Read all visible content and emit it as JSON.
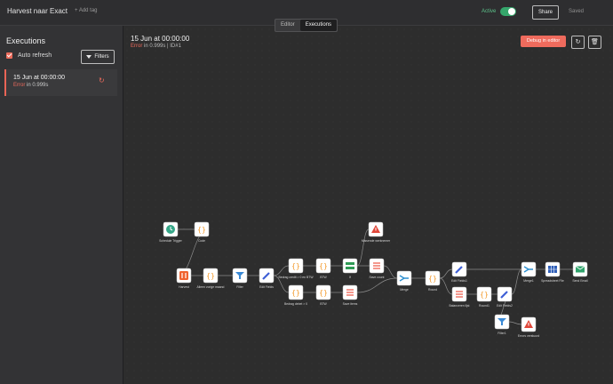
{
  "header": {
    "workflow_title": "Harvest naar Exact",
    "add_tag": "+ Add tag",
    "active_label": "Active",
    "active": true,
    "share_label": "Share",
    "saved_label": "Saved",
    "tabs": [
      {
        "label": "Editor",
        "selected": false
      },
      {
        "label": "Executions",
        "selected": true
      }
    ]
  },
  "sidebar": {
    "title": "Executions",
    "auto_refresh_label": "Auto refresh",
    "auto_refresh_checked": true,
    "filters_label": "Filters",
    "executions": [
      {
        "title": "15 Jun at 00:00:00",
        "status_word": "Error",
        "status_rest": " in 0.999s"
      }
    ]
  },
  "detail": {
    "title": "15 Jun at 00:00:00",
    "status_word": "Error",
    "status_rest": " in 0.999s | ID#1",
    "debug_label": "Debug in editor"
  },
  "colors": {
    "accent": "#ef6b5d",
    "active_green": "#35a66b",
    "canvas_bg": "#2d2d2d",
    "node_bg": "#ffffff"
  },
  "workflow": {
    "nodes": [
      {
        "id": "trigger",
        "label": "Schedule Trigger",
        "icon": "clock-icon",
        "color": "#35a687"
      },
      {
        "id": "code",
        "label": "Code",
        "icon": "braces-icon",
        "color": "#f39c2f"
      },
      {
        "id": "harvest",
        "label": "Harvest",
        "icon": "harvest-icon",
        "color": "#f0632f"
      },
      {
        "id": "alleen",
        "label": "Alleen vorige maand",
        "icon": "braces-icon",
        "color": "#f39c2f"
      },
      {
        "id": "filter1",
        "label": "Filter",
        "icon": "filter-icon",
        "color": "#3a8ad6"
      },
      {
        "id": "edit1",
        "label": "Edit Fields",
        "icon": "pencil-icon",
        "color": "#3f5fd6"
      },
      {
        "id": "bedrag1",
        "label": "Bedrag credit > 0 en BTW",
        "icon": "braces-icon",
        "color": "#f39c2f"
      },
      {
        "id": "btw1",
        "label": "BTW",
        "icon": "braces-icon",
        "color": "#f39c2f"
      },
      {
        "id": "if",
        "label": "If",
        "icon": "if-icon",
        "color": "#2f9b55"
      },
      {
        "id": "save1",
        "label": "Save count",
        "icon": "list-icon",
        "color": "#ef6b5d"
      },
      {
        "id": "bedrag2",
        "label": "Bedrag debet > 0",
        "icon": "braces-icon",
        "color": "#f39c2f"
      },
      {
        "id": "btw2",
        "label": "BTW",
        "icon": "braces-icon",
        "color": "#f39c2f"
      },
      {
        "id": "save2",
        "label": "Save items",
        "icon": "list-icon",
        "color": "#ef6b5d"
      },
      {
        "id": "stop1",
        "label": "Missende werknemer",
        "icon": "warning-icon",
        "color": "#e0473a"
      },
      {
        "id": "merge",
        "label": "Merge",
        "icon": "merge-icon",
        "color": "#2c8fcf"
      },
      {
        "id": "round",
        "label": "Round",
        "icon": "braces-icon",
        "color": "#f39c2f"
      },
      {
        "id": "edit2",
        "label": "Edit Fields1",
        "icon": "pencil-icon",
        "color": "#3f5fd6"
      },
      {
        "id": "list2",
        "label": "Balanceren lijst",
        "icon": "list-icon",
        "color": "#ef6b5d"
      },
      {
        "id": "round2",
        "label": "Round1",
        "icon": "braces-icon",
        "color": "#f39c2f"
      },
      {
        "id": "edit3",
        "label": "Edit Fields2",
        "icon": "pencil-icon",
        "color": "#3f5fd6"
      },
      {
        "id": "merge2",
        "label": "Merge1",
        "icon": "merge-icon",
        "color": "#2c8fcf"
      },
      {
        "id": "sheet",
        "label": "Spreadsheet File",
        "icon": "table-icon",
        "color": "#2f5fb8"
      },
      {
        "id": "email",
        "label": "Send Email",
        "icon": "email-icon",
        "color": "#2fa36b"
      },
      {
        "id": "filter2",
        "label": "Filter1",
        "icon": "filter-icon",
        "color": "#3a8ad6"
      },
      {
        "id": "stop2",
        "label": "Errors verstuurd",
        "icon": "warning-icon",
        "color": "#e0473a"
      }
    ]
  }
}
